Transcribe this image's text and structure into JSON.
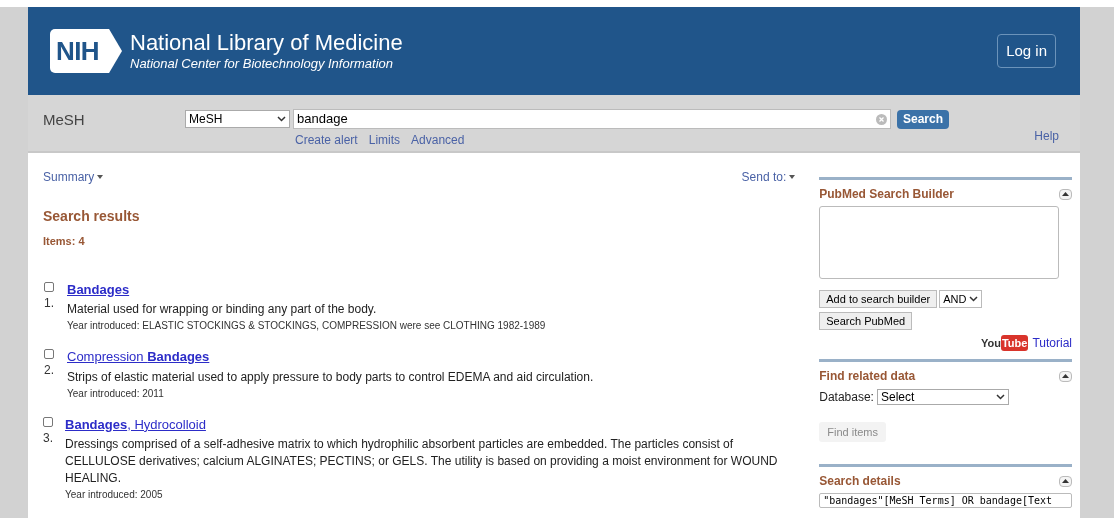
{
  "header": {
    "logo": "NIH",
    "title": "National Library of Medicine",
    "subtitle": "National Center for Biotechnology Information",
    "login": "Log in"
  },
  "search_bar": {
    "label": "MeSH",
    "database": "MeSH",
    "query": "bandage",
    "button": "Search",
    "links": [
      "Create alert",
      "Limits",
      "Advanced"
    ],
    "help": "Help"
  },
  "toolbar": {
    "summary": "Summary",
    "send_to": "Send to:"
  },
  "results": {
    "heading": "Search results",
    "count": "Items: 4",
    "items": [
      {
        "number": "1.",
        "checked": false,
        "title": "**Bandages**",
        "description": "Material used for wrapping or binding any part of the body.",
        "year": "Year introduced: ELASTIC STOCKINGS & STOCKINGS, COMPRESSION were see CLOTHING 1982-1989"
      },
      {
        "number": "2.",
        "checked": false,
        "title": "Compression **Bandages**",
        "description": "Strips of elastic material used to apply pressure to body parts to control EDEMA and aid circulation.",
        "year": "Year introduced: 2011"
      },
      {
        "number": "3.",
        "checked": false,
        "title": "**Bandages**, Hydrocolloid",
        "description": "Dressings comprised of a self-adhesive matrix to which hydrophilic absorbent particles are embedded. The particles consist of CELLULOSE derivatives; calcium ALGINATES; PECTINS; or GELS. The utility is based on providing a moist environment for WOUND HEALING.",
        "year": "Year introduced: 2005"
      }
    ]
  },
  "sidebar": {
    "search_builder": {
      "title": "PubMed Search Builder",
      "add_button": "Add to search builder",
      "operator": "AND",
      "search_button": "Search PubMed",
      "logo": [
        "You",
        "Tube"
      ],
      "tutorial": "Tutorial"
    },
    "related": {
      "title": "Find related data",
      "database_label": "Database:",
      "database": "Select",
      "find_button": "Find items",
      "find_disabled": true
    },
    "details": {
      "title": "Search details",
      "query": "\"bandages\"[MeSH Terms] OR bandage[Text"
    }
  }
}
